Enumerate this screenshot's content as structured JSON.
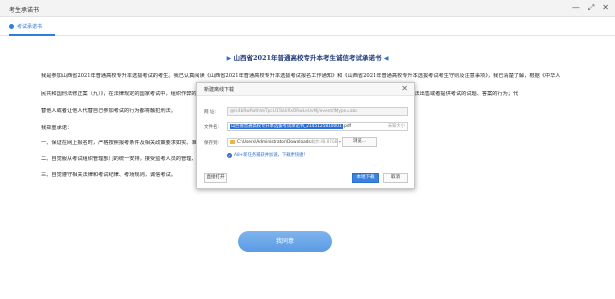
{
  "window": {
    "title": "考生承诺书",
    "controls": [
      "—",
      "⤢",
      "✕"
    ]
  },
  "tab": {
    "label": "考试承诺书"
  },
  "document": {
    "title": "山西省2021年普通高校专升本考生诚信考试承诺书",
    "lines": [
      "我是参加山西省2021年普通高校专升本选拔考试的考生。我已认真阅读《山西省2021年普通高校专升本选拔考试报名工作通知》和《山西省2021年普通高校专升本选拔考试考生守则及注意事项》，我已清楚了解，根据《中华人",
      "民共和国刑法修正案（九）》，在法律规定的国家考试中，组织作弊的行为；为他人实施组织作弊提供作弊器材或者其他帮助的行为；为实施考试作弊行为，向他人非法出售或者提供考试的试题、答案的行为；代",
      "替他人或者让他人代替自己参加考试的行为都将触犯刑法。",
      "我郑重承诺：",
      "一、保证在网上报名时，严格按照报考条件及相关政策要求如实、准确提交报考信息。如不符合报考条件或提供虚假信息的，本人承担由此造成的一切后果。",
      "二、自觉服从考试组织管理部门的统一安排，接受监考人员的管理、监督和检查。",
      "三、自觉遵守相关法律和考试纪律、考场规则，诚信考试。"
    ],
    "agree_button": "我同意"
  },
  "dialog": {
    "title": "新建离线下载",
    "close": "✕",
    "url_label": "网 址:",
    "url_value": "@lc4bRwRathVeTpcU1ToUiRxDRwLeUvMj/event/lMype=abc",
    "filename_label": "文件名:",
    "filename_selected": "山西省普通高校专升本选拔考试承诺书_2145125810001",
    "filename_suffix": ".pdf",
    "filename_size": "未知大小",
    "save_label": "保存到:",
    "save_path": "C:\\Users\\Administrator\\Downloads",
    "space_info": "剩余:48.87GB ▾",
    "browse_button": "浏览...",
    "tip": "A8+新任务捕获并加速，下载更快捷！",
    "open_button": "直接打开",
    "download_button": "本地下载",
    "cancel_button": "取消"
  }
}
